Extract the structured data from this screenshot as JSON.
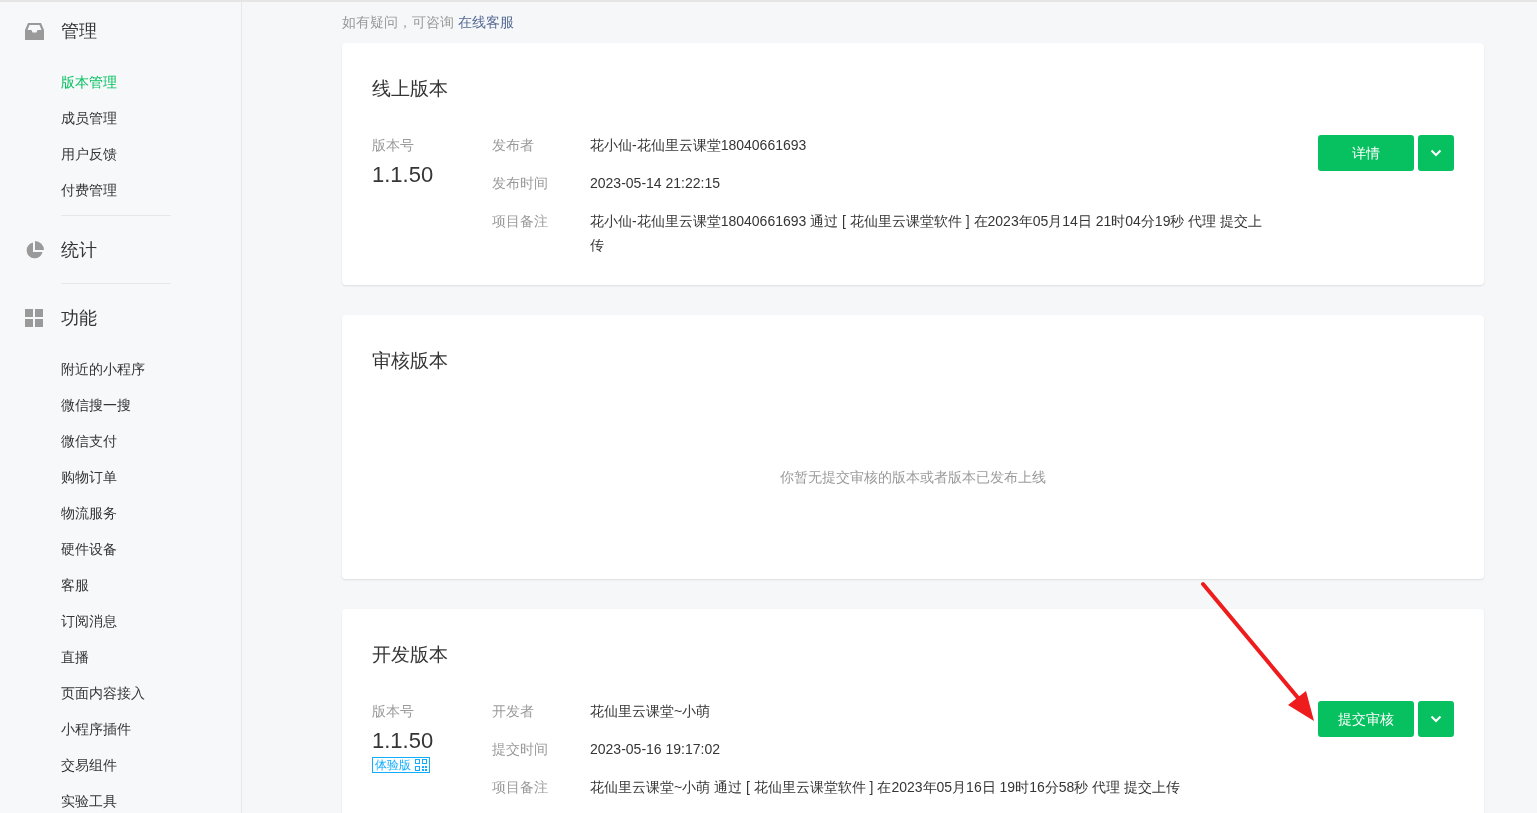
{
  "sidebar": {
    "sections": [
      {
        "kind": "inbox",
        "title": "管理",
        "items": [
          {
            "label": "版本管理",
            "selected": true
          },
          {
            "label": "成员管理",
            "selected": false
          },
          {
            "label": "用户反馈",
            "selected": false
          },
          {
            "label": "付费管理",
            "selected": false
          }
        ]
      },
      {
        "kind": "chart",
        "title": "统计"
      },
      {
        "kind": "grid",
        "title": "功能",
        "items": [
          {
            "label": "附近的小程序",
            "selected": false
          },
          {
            "label": "微信搜一搜",
            "selected": false
          },
          {
            "label": "微信支付",
            "selected": false
          },
          {
            "label": "购物订单",
            "selected": false
          },
          {
            "label": "物流服务",
            "selected": false
          },
          {
            "label": "硬件设备",
            "selected": false
          },
          {
            "label": "客服",
            "selected": false
          },
          {
            "label": "订阅消息",
            "selected": false
          },
          {
            "label": "直播",
            "selected": false
          },
          {
            "label": "页面内容接入",
            "selected": false
          },
          {
            "label": "小程序插件",
            "selected": false
          },
          {
            "label": "交易组件",
            "selected": false
          },
          {
            "label": "实验工具",
            "selected": false
          }
        ]
      }
    ]
  },
  "notice": {
    "text": "如有疑问，可咨询",
    "link": "在线客服"
  },
  "cards": [
    {
      "title": "线上版本",
      "version_label": "版本号",
      "version": "1.1.50",
      "fields": [
        {
          "label": "发布者",
          "value": "花小仙-花仙里云课堂18040661693"
        },
        {
          "label": "发布时间",
          "value": "2023-05-14 21:22:15"
        },
        {
          "label": "项目备注",
          "value": "花小仙-花仙里云课堂18040661693 通过 [ 花仙里云课堂软件 ] 在2023年05月14日 21时04分19秒 代理 提交上传"
        }
      ],
      "button": "详情",
      "arrow": false
    },
    {
      "title": "审核版本",
      "empty": "你暂无提交审核的版本或者版本已发布上线"
    },
    {
      "title": "开发版本",
      "version_label": "版本号",
      "version": "1.1.50",
      "badge": "体验版",
      "fields": [
        {
          "label": "开发者",
          "value": "花仙里云课堂~小萌"
        },
        {
          "label": "提交时间",
          "value": "2023-05-16 19:17:02"
        },
        {
          "label": "项目备注",
          "value": "花仙里云课堂~小萌 通过 [ 花仙里云课堂软件 ] 在2023年05月16日 19时16分58秒 代理 提交上传"
        }
      ],
      "button": "提交审核",
      "arrow": true
    }
  ]
}
